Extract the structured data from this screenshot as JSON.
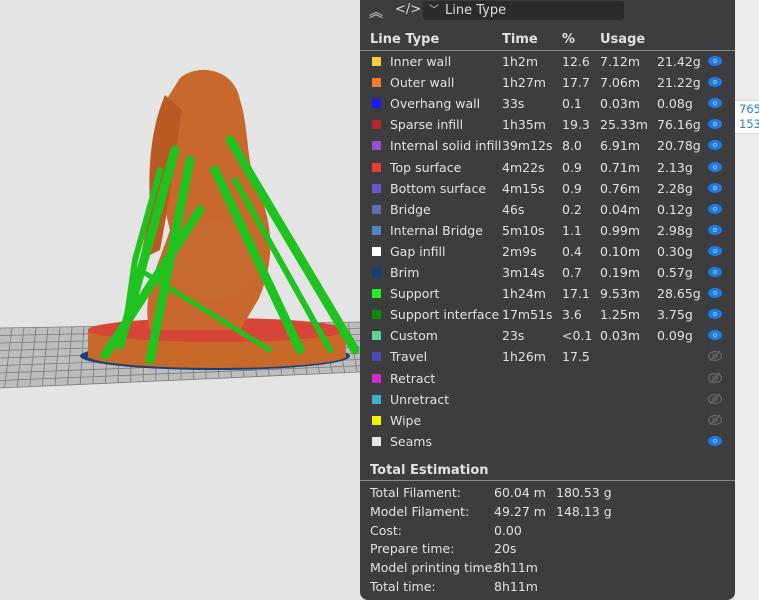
{
  "toolbar": {
    "view_type": "Line Type",
    "collapse_icon": "double-chevron-up-icon",
    "code_icon": "code-icon"
  },
  "table": {
    "headers": {
      "line_type": "Line Type",
      "time": "Time",
      "percent": "%",
      "usage": "Usage"
    },
    "rows": [
      {
        "name": "Inner wall",
        "time": "1h2m",
        "percent": "12.6",
        "length": "7.12m",
        "weight": "21.42g",
        "color": "#f2d23a",
        "visible": true
      },
      {
        "name": "Outer wall",
        "time": "1h27m",
        "percent": "17.7",
        "length": "7.06m",
        "weight": "21.22g",
        "color": "#ef7c35",
        "visible": true
      },
      {
        "name": "Overhang wall",
        "time": "33s",
        "percent": "0.1",
        "length": "0.03m",
        "weight": "0.08g",
        "color": "#1a1aff",
        "visible": true
      },
      {
        "name": "Sparse infill",
        "time": "1h35m",
        "percent": "19.3",
        "length": "25.33m",
        "weight": "76.16g",
        "color": "#b02a2a",
        "visible": true
      },
      {
        "name": "Internal solid infill",
        "time": "39m12s",
        "percent": "8.0",
        "length": "6.91m",
        "weight": "20.78g",
        "color": "#9a4fd0",
        "visible": true
      },
      {
        "name": "Top surface",
        "time": "4m22s",
        "percent": "0.9",
        "length": "0.71m",
        "weight": "2.13g",
        "color": "#e83c3c",
        "visible": true
      },
      {
        "name": "Bottom surface",
        "time": "4m15s",
        "percent": "0.9",
        "length": "0.76m",
        "weight": "2.28g",
        "color": "#6a55cc",
        "visible": true
      },
      {
        "name": "Bridge",
        "time": "46s",
        "percent": "0.2",
        "length": "0.04m",
        "weight": "0.12g",
        "color": "#5a6fb0",
        "visible": true
      },
      {
        "name": "Internal Bridge",
        "time": "5m10s",
        "percent": "1.1",
        "length": "0.99m",
        "weight": "2.98g",
        "color": "#4f86c8",
        "visible": true
      },
      {
        "name": "Gap infill",
        "time": "2m9s",
        "percent": "0.4",
        "length": "0.10m",
        "weight": "0.30g",
        "color": "#ffffff",
        "visible": true
      },
      {
        "name": "Brim",
        "time": "3m14s",
        "percent": "0.7",
        "length": "0.19m",
        "weight": "0.57g",
        "color": "#0d3f7a",
        "visible": true
      },
      {
        "name": "Support",
        "time": "1h24m",
        "percent": "17.1",
        "length": "9.53m",
        "weight": "28.65g",
        "color": "#22ee22",
        "visible": true
      },
      {
        "name": "Support interface",
        "time": "17m51s",
        "percent": "3.6",
        "length": "1.25m",
        "weight": "3.75g",
        "color": "#0f8a0f",
        "visible": true
      },
      {
        "name": "Custom",
        "time": "23s",
        "percent": "<0.1",
        "length": "0.03m",
        "weight": "0.09g",
        "color": "#5ed19a",
        "visible": true
      },
      {
        "name": "Travel",
        "time": "1h26m",
        "percent": "17.5",
        "length": "",
        "weight": "",
        "color": "#4a4ab0",
        "visible": false
      },
      {
        "name": "Retract",
        "time": "",
        "percent": "",
        "length": "",
        "weight": "",
        "color": "#d22ad2",
        "visible": false
      },
      {
        "name": "Unretract",
        "time": "",
        "percent": "",
        "length": "",
        "weight": "",
        "color": "#3fb0c8",
        "visible": false
      },
      {
        "name": "Wipe",
        "time": "",
        "percent": "",
        "length": "",
        "weight": "",
        "color": "#f2f200",
        "visible": false
      },
      {
        "name": "Seams",
        "time": "",
        "percent": "",
        "length": "",
        "weight": "",
        "color": "#e6e6e6",
        "visible": true
      }
    ]
  },
  "total": {
    "title": "Total Estimation",
    "rows": [
      {
        "label": "Total Filament:",
        "value": "60.04 m",
        "value2": "180.53 g"
      },
      {
        "label": "Model Filament:",
        "value": "49.27 m",
        "value2": "148.13 g"
      },
      {
        "label": "Cost:",
        "value": "0.00",
        "value2": ""
      },
      {
        "label": "Prepare time:",
        "value": "20s",
        "value2": ""
      },
      {
        "label": "Model printing time:",
        "value": "8h11m",
        "value2": ""
      },
      {
        "label": "Total time:",
        "value": "8h11m",
        "value2": ""
      }
    ]
  },
  "coords": {
    "line1": "765",
    "line2": "153."
  },
  "colors": {
    "panel": "#3d3d3f",
    "eye_on": "#1f7ae0",
    "eye_off": "#6a6a6a"
  }
}
